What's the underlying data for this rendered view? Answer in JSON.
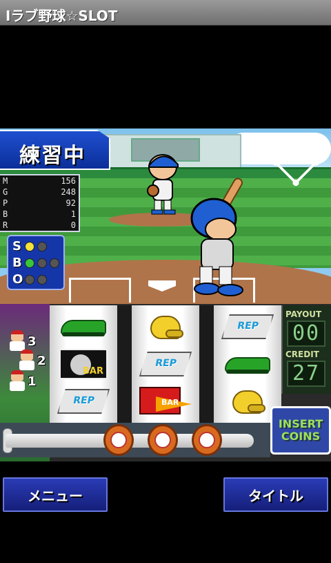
{
  "app": {
    "title": "Iラブ野球☆SLOT"
  },
  "game": {
    "mode_label": "練習中",
    "stats": [
      {
        "key": "M",
        "value": "156"
      },
      {
        "key": "G",
        "value": "248"
      },
      {
        "key": "P",
        "value": "92"
      },
      {
        "key": "B",
        "value": "1"
      },
      {
        "key": "R",
        "value": "0"
      }
    ],
    "count": {
      "strikes": {
        "letter": "S",
        "lit": 1,
        "total": 2
      },
      "balls": {
        "letter": "B",
        "lit": 1,
        "total": 3
      },
      "outs": {
        "letter": "O",
        "lit": 0,
        "total": 2
      }
    },
    "runners": [
      "3",
      "2",
      "1"
    ],
    "colors": {
      "strike": "#f3e23b",
      "ball": "#38c53a",
      "off": "#555555",
      "practice_bg": "#1f4fd0"
    }
  },
  "slot": {
    "reels": [
      [
        {
          "symbol": "shoe"
        },
        {
          "symbol": "bar",
          "label": "BAR"
        },
        {
          "symbol": "rep",
          "label": "REP"
        }
      ],
      [
        {
          "symbol": "helmet"
        },
        {
          "symbol": "rep",
          "label": "REP"
        },
        {
          "symbol": "seven-bar",
          "label": "BAR"
        }
      ],
      [
        {
          "symbol": "rep",
          "label": "REP"
        },
        {
          "symbol": "shoe"
        },
        {
          "symbol": "helmet"
        }
      ]
    ],
    "payout": {
      "label": "PAYOUT",
      "value": "00"
    },
    "credit": {
      "label": "CREDIT",
      "value": "27"
    },
    "insert_coins": [
      "INSERT",
      "COINS"
    ],
    "stop_buttons": 3
  },
  "buttons": {
    "menu": "メニュー",
    "title": "タイトル"
  }
}
